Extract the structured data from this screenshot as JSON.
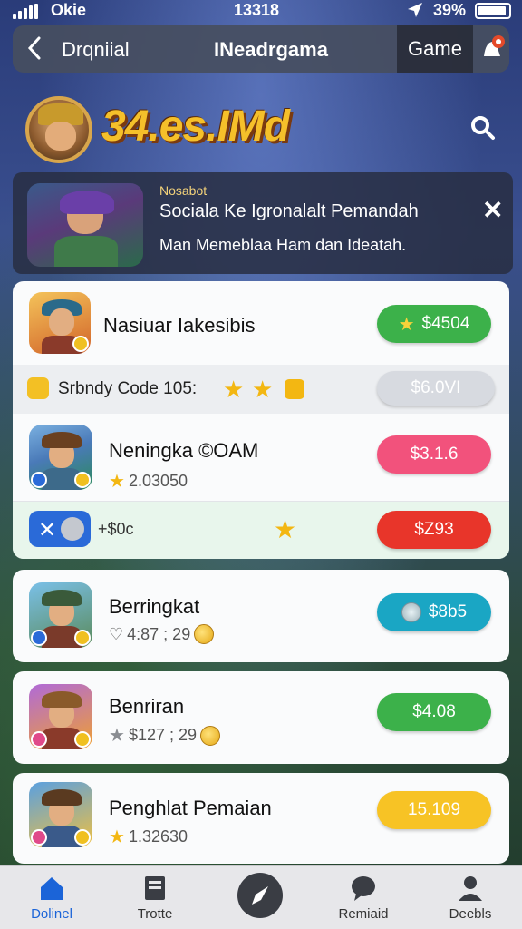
{
  "status_bar": {
    "carrier": "Okie",
    "time": "13318",
    "battery": "39%"
  },
  "top_bar": {
    "back_label": "Drqniial",
    "title": "INeadrgama",
    "game_label": "Game"
  },
  "hero": {
    "logo_text": "34.es.IMd"
  },
  "banner": {
    "sender": "Nosabot",
    "message": "Sociala Ke Igronalalt Pemandah",
    "detail": "Man Memeblaa Ham dan Ideatah."
  },
  "featured": {
    "title": "Nasiuar Iakesibis",
    "price": "$4504",
    "color": "#3cb14a"
  },
  "code_row": {
    "label": "Srbndy Code 105:",
    "price": "$6.0VI"
  },
  "items": [
    {
      "title": "Neningka ©OAM",
      "sub": "2.03050",
      "sub_prefix": "star",
      "price": "$3.1.6",
      "color": "#f2527c"
    },
    {
      "title": "Berringkat",
      "sub": "4:87 ; 29",
      "sub_prefix": "heart",
      "price": "$8b5",
      "color": "#1aa6c4"
    },
    {
      "title": "Benriran",
      "sub": "$127 ; 29",
      "sub_prefix": "star-grey",
      "price": "$4.08",
      "color": "#3cb14a"
    },
    {
      "title": "Penghlat Pemaian",
      "sub": "1.32630",
      "sub_prefix": "star",
      "price": "15.109",
      "color": "#f7c325"
    }
  ],
  "promo_row": {
    "label": "+$0c",
    "price": "$Z93",
    "color": "#e8352a"
  },
  "bottom_nav": [
    {
      "label": "Dolinel",
      "icon": "home-icon"
    },
    {
      "label": "Trotte",
      "icon": "document-icon"
    },
    {
      "label": "",
      "icon": "compass-icon"
    },
    {
      "label": "Remiaid",
      "icon": "chat-icon"
    },
    {
      "label": "Deebls",
      "icon": "profile-icon"
    }
  ],
  "colors": {
    "accent": "#1b64d8",
    "background": "#2a3c79"
  }
}
